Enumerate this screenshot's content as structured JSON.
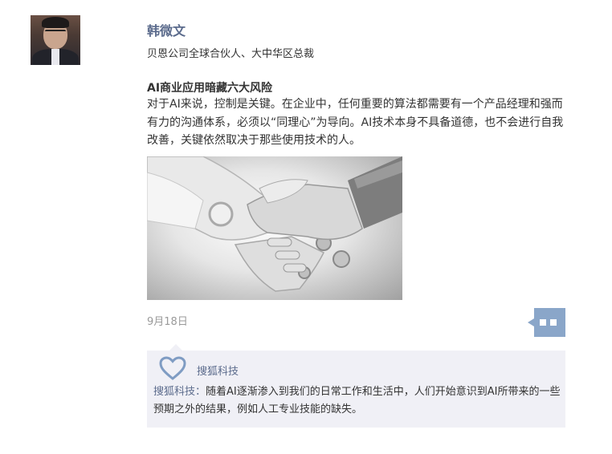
{
  "author": {
    "name": "韩微文",
    "title": "贝恩公司全球合伙人、大中华区总裁"
  },
  "post": {
    "title": "AI商业应用暗藏六大风险",
    "body": "对于AI来说，控制是关键。在企业中，任何重要的算法都需要有一个产品经理和强而有力的沟通体系，必须以“同理心”为导向。AI技术本身不具备道德，也不会进行自我改善，关键依然取决于那些使用技术的人。",
    "date": "9月18日"
  },
  "likes": {
    "name": "搜狐科技"
  },
  "comments": [
    {
      "author": "搜狐科技：",
      "text": "随着AI逐渐渗入到我们的日常工作和生活中，人们开始意识到AI所带来的一些预期之外的结果，例如人工专业技能的缺失。"
    }
  ],
  "colors": {
    "link": "#5b6b8c",
    "comment_button": "#8aa6c9",
    "panel_bg": "#f0f0f6"
  },
  "icons": {
    "comment_button": "comment-dots-icon",
    "like": "heart-icon"
  }
}
